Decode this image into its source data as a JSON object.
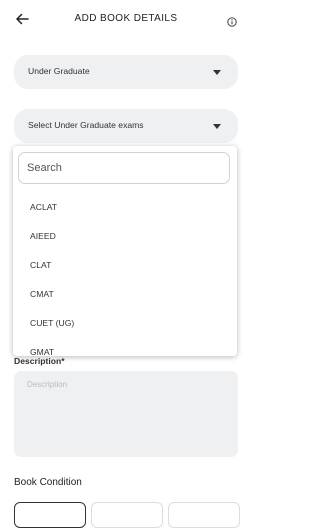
{
  "header": {
    "title": "ADD BOOK DETAILS"
  },
  "level_select": {
    "value": "Under Graduate"
  },
  "exam_select": {
    "value": "Select Under Graduate exams"
  },
  "dropdown": {
    "search_placeholder": "Search",
    "options": [
      "ACLAT",
      "AIEED",
      "CLAT",
      "CMAT",
      "CUET (UG)",
      "GMAT"
    ]
  },
  "description": {
    "label": "Description*",
    "placeholder": "Description"
  },
  "book_condition": {
    "label": "Book Condition"
  },
  "icons": {
    "back": "arrow-left-icon",
    "info": "info-icon",
    "caret": "caret-down-icon"
  },
  "colors": {
    "field_bg": "#eef0f2",
    "text": "#333333"
  }
}
